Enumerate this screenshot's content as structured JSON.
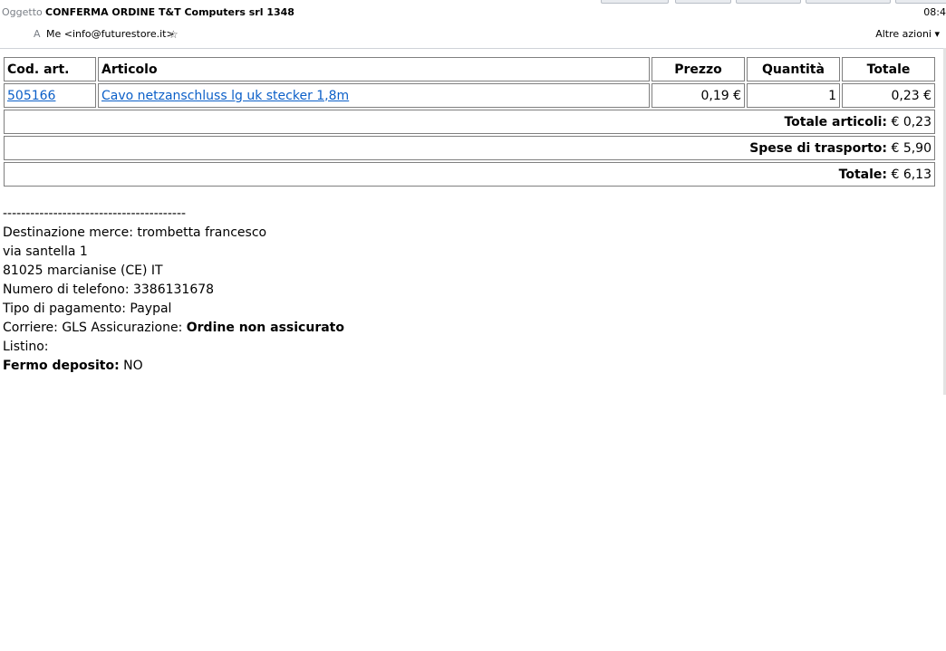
{
  "header": {
    "subject_label": "Oggetto",
    "subject": "CONFERMA ORDINE T&T Computers srl 1348",
    "time": "08:4",
    "to_label": "A",
    "to": "Me <info@futurestore.it>",
    "star_icon": "star-outline-icon",
    "more_actions": "Altre azioni ▾"
  },
  "order_table": {
    "headers": {
      "code": "Cod. art.",
      "article": "Articolo",
      "price": "Prezzo",
      "quantity": "Quantità",
      "total": "Totale"
    },
    "row": {
      "code": "505166",
      "article": "Cavo netzanschluss lg uk stecker 1,8m",
      "price": "0,19 €",
      "quantity": "1",
      "total": "0,23 €"
    },
    "subtotal_label": "Totale articoli:",
    "subtotal_value": "€ 0,23",
    "shipping_label": "Spese di trasporto:",
    "shipping_value": "€ 5,90",
    "grand_total_label": "Totale:",
    "grand_total_value": "€ 6,13"
  },
  "details": {
    "separator": "----------------------------------------",
    "destination": "Destinazione merce: trombetta francesco",
    "street": "via santella 1",
    "city": "81025 marcianise (CE) IT",
    "phone": "Numero di telefono: 3386131678",
    "payment": "Tipo di pagamento: Paypal",
    "courier_prefix": "Corriere: GLS Assicurazione: ",
    "courier_insurance": "Ordine non assicurato",
    "price_list": "Listino:",
    "pickup_label": "Fermo deposito:",
    "pickup_value": " NO"
  }
}
